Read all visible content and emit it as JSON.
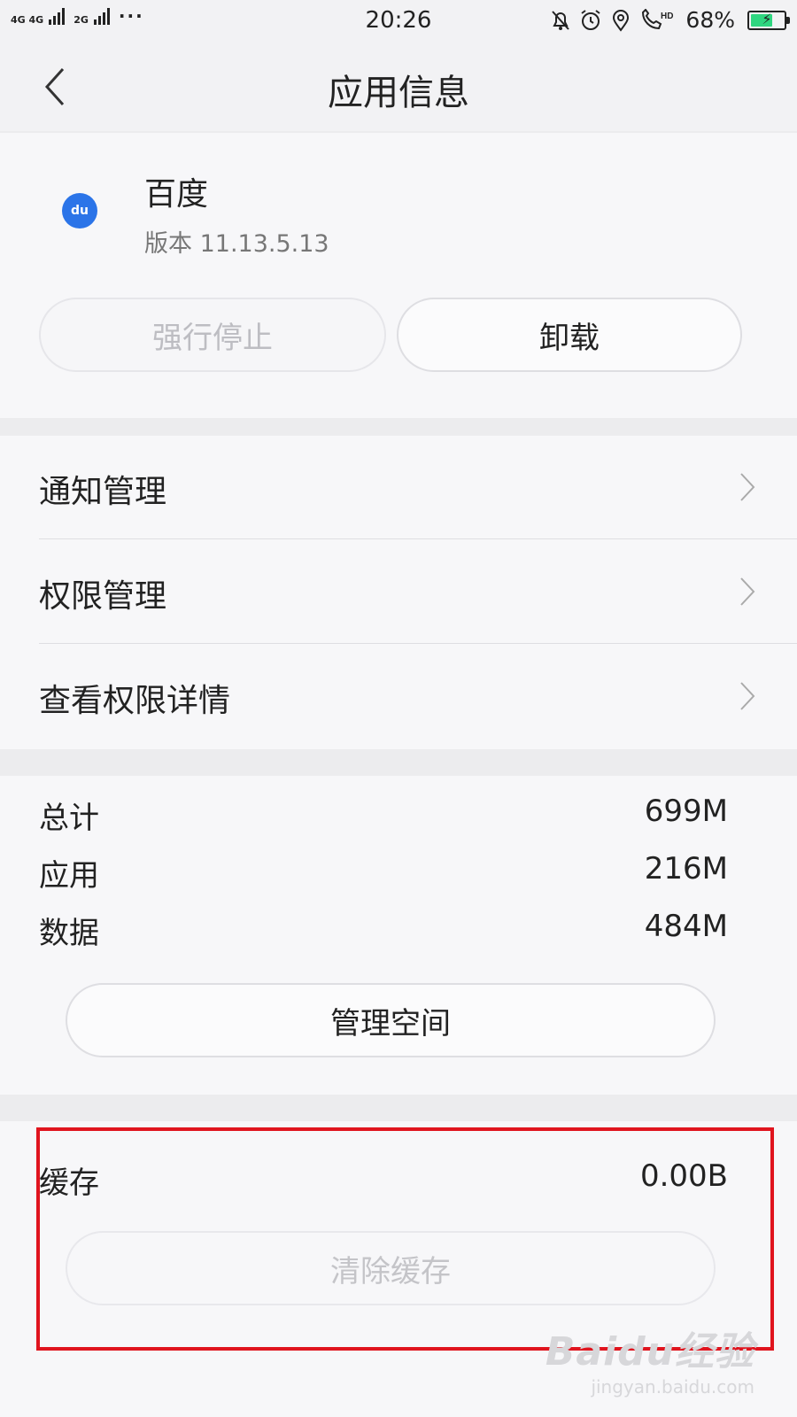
{
  "status_bar": {
    "signal_1_label": "4G 4G",
    "signal_2_label": "2G",
    "more_dots": "···",
    "time": "20:26",
    "battery_percent": "68%",
    "battery_level": 0.68,
    "battery_color": "#2fd680",
    "icons": [
      "mute-bell-icon",
      "alarm-icon",
      "location-icon",
      "hd-call-icon",
      "battery-charging-icon"
    ]
  },
  "nav": {
    "title": "应用信息",
    "back_icon": "chevron-left-icon"
  },
  "app": {
    "name": "百度",
    "version": "版本 11.13.5.13",
    "icon_text": "du",
    "icon_color": "#2b74e8",
    "force_stop_label": "强行停止",
    "uninstall_label": "卸载"
  },
  "menu": {
    "items": [
      {
        "label": "通知管理"
      },
      {
        "label": "权限管理"
      },
      {
        "label": "查看权限详情"
      }
    ]
  },
  "storage": {
    "rows": [
      {
        "label": "总计",
        "value": "699M"
      },
      {
        "label": "应用",
        "value": "216M"
      },
      {
        "label": "数据",
        "value": "484M"
      }
    ],
    "manage_label": "管理空间"
  },
  "cache": {
    "label": "缓存",
    "value": "0.00B",
    "clear_label": "清除缓存",
    "highlight_color": "#e0141e"
  },
  "watermark": {
    "logo": "Baidu经验",
    "url": "jingyan.baidu.com"
  }
}
